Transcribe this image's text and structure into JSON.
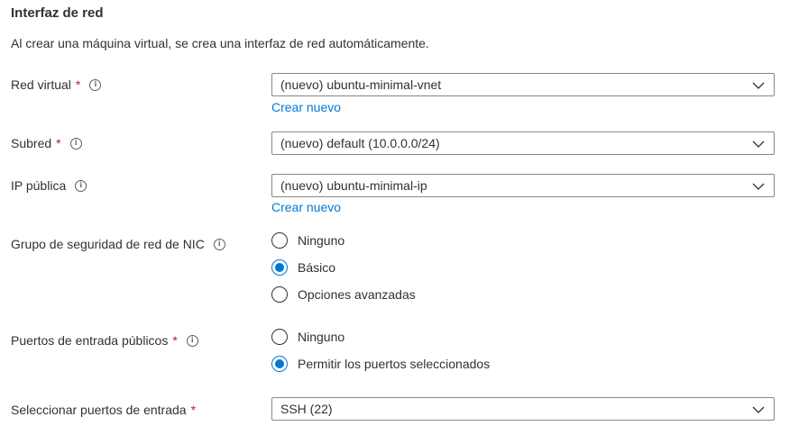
{
  "section": {
    "title": "Interfaz de red",
    "description": "Al crear una máquina virtual, se crea una interfaz de red automáticamente."
  },
  "vnet": {
    "label": "Red virtual",
    "required": "*",
    "value": "(nuevo) ubuntu-minimal-vnet",
    "create_link": "Crear nuevo"
  },
  "subnet": {
    "label": "Subred",
    "required": "*",
    "value": "(nuevo) default (10.0.0.0/24)"
  },
  "public_ip": {
    "label": "IP pública",
    "value": "(nuevo) ubuntu-minimal-ip",
    "create_link": "Crear nuevo"
  },
  "nsg": {
    "label": "Grupo de seguridad de red de NIC",
    "options": [
      "Ninguno",
      "Básico",
      "Opciones avanzadas"
    ],
    "selected": "Básico"
  },
  "public_ports": {
    "label": "Puertos de entrada públicos",
    "required": "*",
    "options": [
      "Ninguno",
      "Permitir los puertos seleccionados"
    ],
    "selected": "Permitir los puertos seleccionados"
  },
  "inbound_ports": {
    "label": "Seleccionar puertos de entrada",
    "required": "*",
    "value": "SSH (22)"
  },
  "colors": {
    "accent": "#0078d4",
    "required": "#a4262c",
    "text": "#323130"
  },
  "icons": {
    "info": "info-icon",
    "dropdown": "chevron-down-icon"
  }
}
